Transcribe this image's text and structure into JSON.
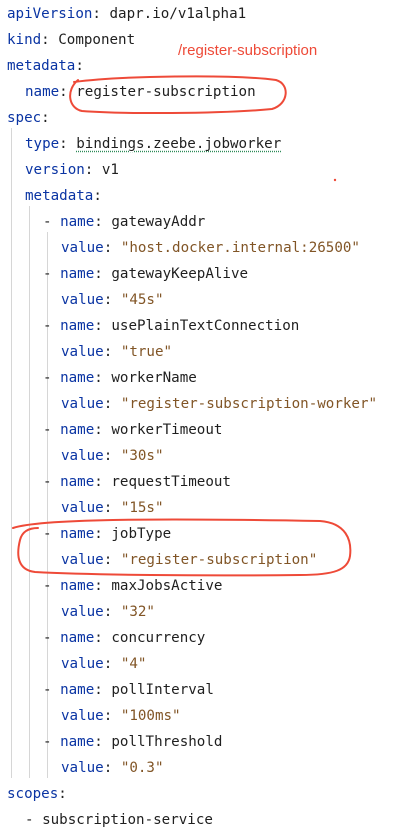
{
  "annotation": {
    "label": "/register-subscription"
  },
  "yaml": {
    "apiVersion": {
      "key": "apiVersion",
      "value": "dapr.io/v1alpha1"
    },
    "kind": {
      "key": "kind",
      "value": "Component"
    },
    "metadata": {
      "key": "metadata",
      "name_key": "name",
      "name_value": "register-subscription"
    },
    "spec": {
      "key": "spec",
      "type_key": "type",
      "type_value": "bindings.zeebe.jobworker",
      "version_key": "version",
      "version_value": "v1",
      "metadata_key": "metadata",
      "items": [
        {
          "name_key": "name",
          "name": "gatewayAddr",
          "value_key": "value",
          "value": "\"host.docker.internal:26500\""
        },
        {
          "name_key": "name",
          "name": "gatewayKeepAlive",
          "value_key": "value",
          "value": "\"45s\""
        },
        {
          "name_key": "name",
          "name": "usePlainTextConnection",
          "value_key": "value",
          "value": "\"true\""
        },
        {
          "name_key": "name",
          "name": "workerName",
          "value_key": "value",
          "value": "\"register-subscription-worker\""
        },
        {
          "name_key": "name",
          "name": "workerTimeout",
          "value_key": "value",
          "value": "\"30s\""
        },
        {
          "name_key": "name",
          "name": "requestTimeout",
          "value_key": "value",
          "value": "\"15s\""
        },
        {
          "name_key": "name",
          "name": "jobType",
          "value_key": "value",
          "value": "\"register-subscription\""
        },
        {
          "name_key": "name",
          "name": "maxJobsActive",
          "value_key": "value",
          "value": "\"32\""
        },
        {
          "name_key": "name",
          "name": "concurrency",
          "value_key": "value",
          "value": "\"4\""
        },
        {
          "name_key": "name",
          "name": "pollInterval",
          "value_key": "value",
          "value": "\"100ms\""
        },
        {
          "name_key": "name",
          "name": "pollThreshold",
          "value_key": "value",
          "value": "\"0.3\""
        }
      ]
    },
    "scopes": {
      "key": "scopes",
      "items": [
        "subscription-service"
      ]
    }
  },
  "colors": {
    "key": "#0a34a3",
    "string": "#815526",
    "annotation": "#ee4a38",
    "guide": "#d6d6d6"
  }
}
